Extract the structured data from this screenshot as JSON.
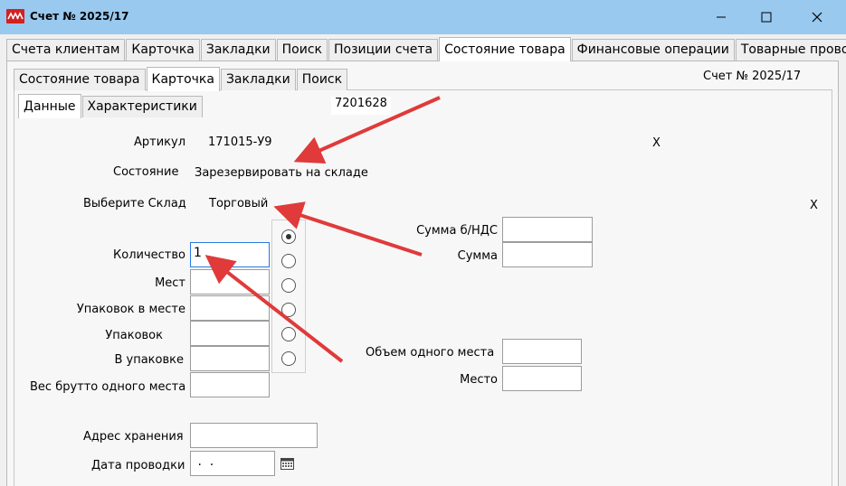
{
  "window": {
    "title": "Счет № 2025/17",
    "logo_text": "ꓥꓥꓥ",
    "app_icon": "app-logo-icon",
    "minimize_icon": "minimize-icon",
    "maximize_icon": "maximize-icon",
    "close_icon": "close-icon"
  },
  "tabs_main": [
    "Счета клиентам",
    "Карточка",
    "Закладки",
    "Поиск",
    "Позиции счета",
    "Состояние товара",
    "Финансовые операции",
    "Товарные проводки"
  ],
  "tabs_main_active": "Состояние товара",
  "tabs_sub": [
    "Состояние товара",
    "Карточка",
    "Закладки",
    "Поиск"
  ],
  "tabs_sub_active": "Карточка",
  "tabs_inner": [
    "Данные",
    "Характеристики"
  ],
  "tabs_inner_active": "Данные",
  "header": {
    "invoice_label": "Счет № 2025/17",
    "code": "7201628"
  },
  "form": {
    "article_label": "Артикул",
    "article_value": "171015-У9",
    "article_clear": "X",
    "state_label": "Состояние",
    "state_value": "Зарезервировать на складе",
    "warehouse_label": "Выберите Склад",
    "warehouse_value": "Торговый",
    "warehouse_clear": "X",
    "quantity_label": "Количество",
    "quantity_value": "1",
    "places_label": "Мест",
    "packs_per_place_label": "Упаковок в месте",
    "packs_label": "Упаковок",
    "per_pack_label": "В упаковке",
    "gross_weight_label": "Вес брутто одного места",
    "sum_no_vat_label": "Сумма  б/НДС",
    "sum_label": "Сумма",
    "volume_label": "Объем одного места",
    "place_label": "Место",
    "address_label": "Адрес хранения",
    "date_label": "Дата проводки",
    "date_value": " .  .",
    "calendar_icon": "calendar-icon"
  },
  "radio_options": {
    "selected_index": 0,
    "count": 6
  },
  "colors": {
    "titlebar": "#99c9ef",
    "arrow": "#e03a3a",
    "logo": "#d61f1f"
  }
}
